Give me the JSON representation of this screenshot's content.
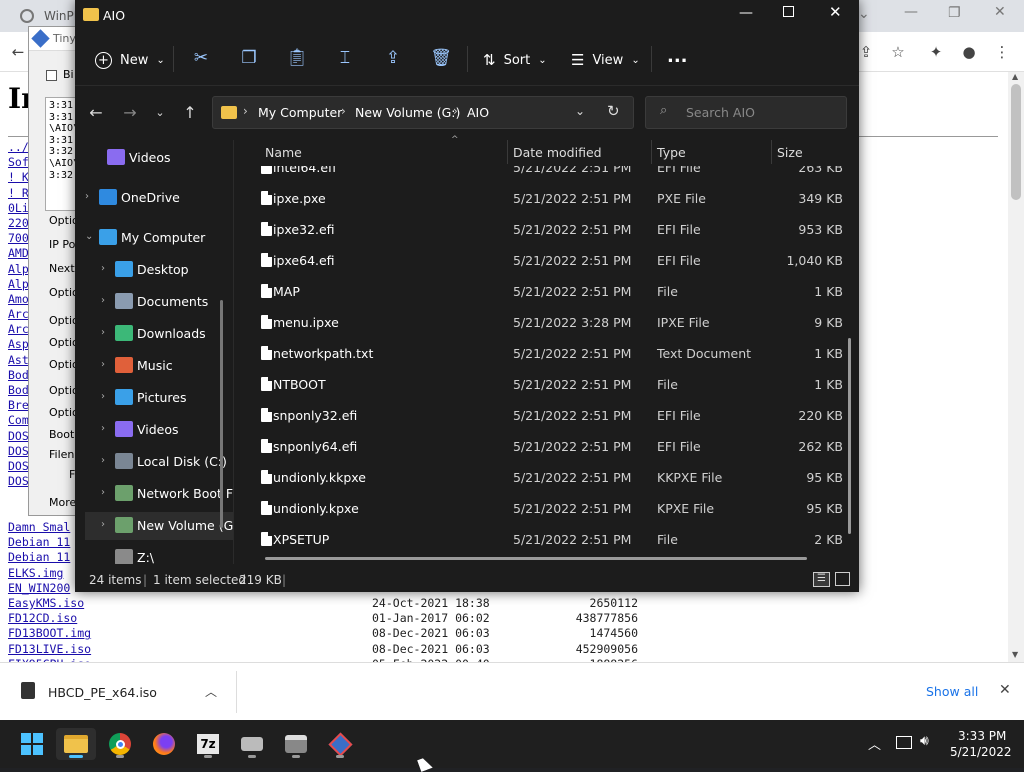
{
  "chrome": {
    "tab_title": "WinPE",
    "page_heading": "In",
    "listing_visible": [
      "../",
      "Sof",
      "! K",
      "! R",
      "0Li",
      "220",
      "700",
      "AMD",
      "Alp",
      "Alp",
      "Amo",
      "Arc",
      "Arc",
      "Asp",
      "Ast",
      "Bod",
      "Bod",
      "Bre",
      "Com",
      "DOS",
      "DOS",
      "DOS",
      "DOS"
    ],
    "listing_full": [
      {
        "name": "Damn Smal",
        "date": "",
        "size": ""
      },
      {
        "name": "Debian 11",
        "date": "",
        "size": ""
      },
      {
        "name": "Debian 11",
        "date": "",
        "size": ""
      },
      {
        "name": "ELKS.img",
        "date": "",
        "size": ""
      },
      {
        "name": "EN_WIN200",
        "date": "",
        "size": ""
      },
      {
        "name": "EasyKMS.iso",
        "date": "24-Oct-2021 18:38",
        "size": "2650112"
      },
      {
        "name": "FD12CD.iso",
        "date": "01-Jan-2017 06:02",
        "size": "438777856"
      },
      {
        "name": "FD13BOOT.img",
        "date": "08-Dec-2021 06:03",
        "size": "1474560"
      },
      {
        "name": "FD13LIVE.iso",
        "date": "08-Dec-2021 06:03",
        "size": "452909056"
      },
      {
        "name": "FIX95CPU.iso",
        "date": "05-Feb-2022 00:40",
        "size": "1888256"
      }
    ]
  },
  "tinypxe": {
    "title": "Tiny",
    "checkbox_label": "Bi",
    "log": [
      "3:31:",
      "3:31:",
      "\\AIO\\",
      "3:31:",
      "3:32:",
      "\\AIO\\",
      "3:32:"
    ],
    "labels": [
      "Optio",
      "IP Po",
      "Next-",
      "Optio",
      "Optio",
      "Optio",
      "Optio",
      "Optio",
      "Optio",
      "Boot",
      "Filena",
      "F",
      "More"
    ]
  },
  "explorer": {
    "title": "AIO",
    "toolbar": {
      "new_label": "New",
      "sort_label": "Sort",
      "view_label": "View",
      "more_label": "..."
    },
    "breadcrumb": [
      "My Computer",
      "New Volume (G:)",
      "AIO"
    ],
    "search_placeholder": "Search AIO",
    "sidebar": [
      {
        "label": "Videos",
        "icon": "videos-icon",
        "color": "#8a6cf0"
      },
      {
        "label": "OneDrive",
        "icon": "cloud-icon",
        "color": "#2f8ae0"
      },
      {
        "label": "My Computer",
        "icon": "computer-icon",
        "color": "#3aa0e8"
      },
      {
        "label": "Desktop",
        "icon": "desktop-icon",
        "color": "#3aa0e8"
      },
      {
        "label": "Documents",
        "icon": "documents-icon",
        "color": "#8a9bb0"
      },
      {
        "label": "Downloads",
        "icon": "downloads-icon",
        "color": "#3cb878"
      },
      {
        "label": "Music",
        "icon": "music-icon",
        "color": "#e0603a"
      },
      {
        "label": "Pictures",
        "icon": "pictures-icon",
        "color": "#3aa0e8"
      },
      {
        "label": "Videos",
        "icon": "videos-icon",
        "color": "#8a6cf0"
      },
      {
        "label": "Local Disk (C:)",
        "icon": "drive-icon",
        "color": "#7a8694"
      },
      {
        "label": "Network Boot F",
        "icon": "network-drive-icon",
        "color": "#6ca06c"
      },
      {
        "label": "New Volume (G",
        "icon": "drive-icon",
        "color": "#6ca06c"
      },
      {
        "label": "Z:\\",
        "icon": "drive-icon",
        "color": "#8a8a8a"
      }
    ],
    "columns": {
      "name": "Name",
      "date": "Date modified",
      "type": "Type",
      "size": "Size"
    },
    "files": [
      {
        "name": "intel64.efi",
        "date": "5/21/2022 2:51 PM",
        "type": "EFI File",
        "size": "263 KB"
      },
      {
        "name": "ipxe.pxe",
        "date": "5/21/2022 2:51 PM",
        "type": "PXE File",
        "size": "349 KB"
      },
      {
        "name": "ipxe32.efi",
        "date": "5/21/2022 2:51 PM",
        "type": "EFI File",
        "size": "953 KB"
      },
      {
        "name": "ipxe64.efi",
        "date": "5/21/2022 2:51 PM",
        "type": "EFI File",
        "size": "1,040 KB"
      },
      {
        "name": "MAP",
        "date": "5/21/2022 2:51 PM",
        "type": "File",
        "size": "1 KB"
      },
      {
        "name": "menu.ipxe",
        "date": "5/21/2022 3:28 PM",
        "type": "IPXE File",
        "size": "9 KB"
      },
      {
        "name": "networkpath.txt",
        "date": "5/21/2022 2:51 PM",
        "type": "Text Document",
        "size": "1 KB"
      },
      {
        "name": "NTBOOT",
        "date": "5/21/2022 2:51 PM",
        "type": "File",
        "size": "1 KB"
      },
      {
        "name": "snponly32.efi",
        "date": "5/21/2022 2:51 PM",
        "type": "EFI File",
        "size": "220 KB"
      },
      {
        "name": "snponly64.efi",
        "date": "5/21/2022 2:51 PM",
        "type": "EFI File",
        "size": "262 KB"
      },
      {
        "name": "undionly.kkpxe",
        "date": "5/21/2022 2:51 PM",
        "type": "KKPXE File",
        "size": "95 KB"
      },
      {
        "name": "undionly.kpxe",
        "date": "5/21/2022 2:51 PM",
        "type": "KPXE File",
        "size": "95 KB"
      },
      {
        "name": "XPSETUP",
        "date": "5/21/2022 2:51 PM",
        "type": "File",
        "size": "2 KB"
      }
    ],
    "status": {
      "items": "24 items",
      "selected": "1 item selected",
      "selected_size": "219 KB"
    }
  },
  "download_bar": {
    "file_name": "HBCD_PE_x64.iso",
    "show_all": "Show all"
  },
  "taskbar": {
    "time": "3:33 PM",
    "date": "5/21/2022",
    "apps": [
      "start-icon",
      "file-explorer-icon",
      "chrome-icon",
      "firefox-icon",
      "7zip-icon",
      "drive-tool-icon",
      "network-tool-icon",
      "tinypxe-icon"
    ]
  }
}
